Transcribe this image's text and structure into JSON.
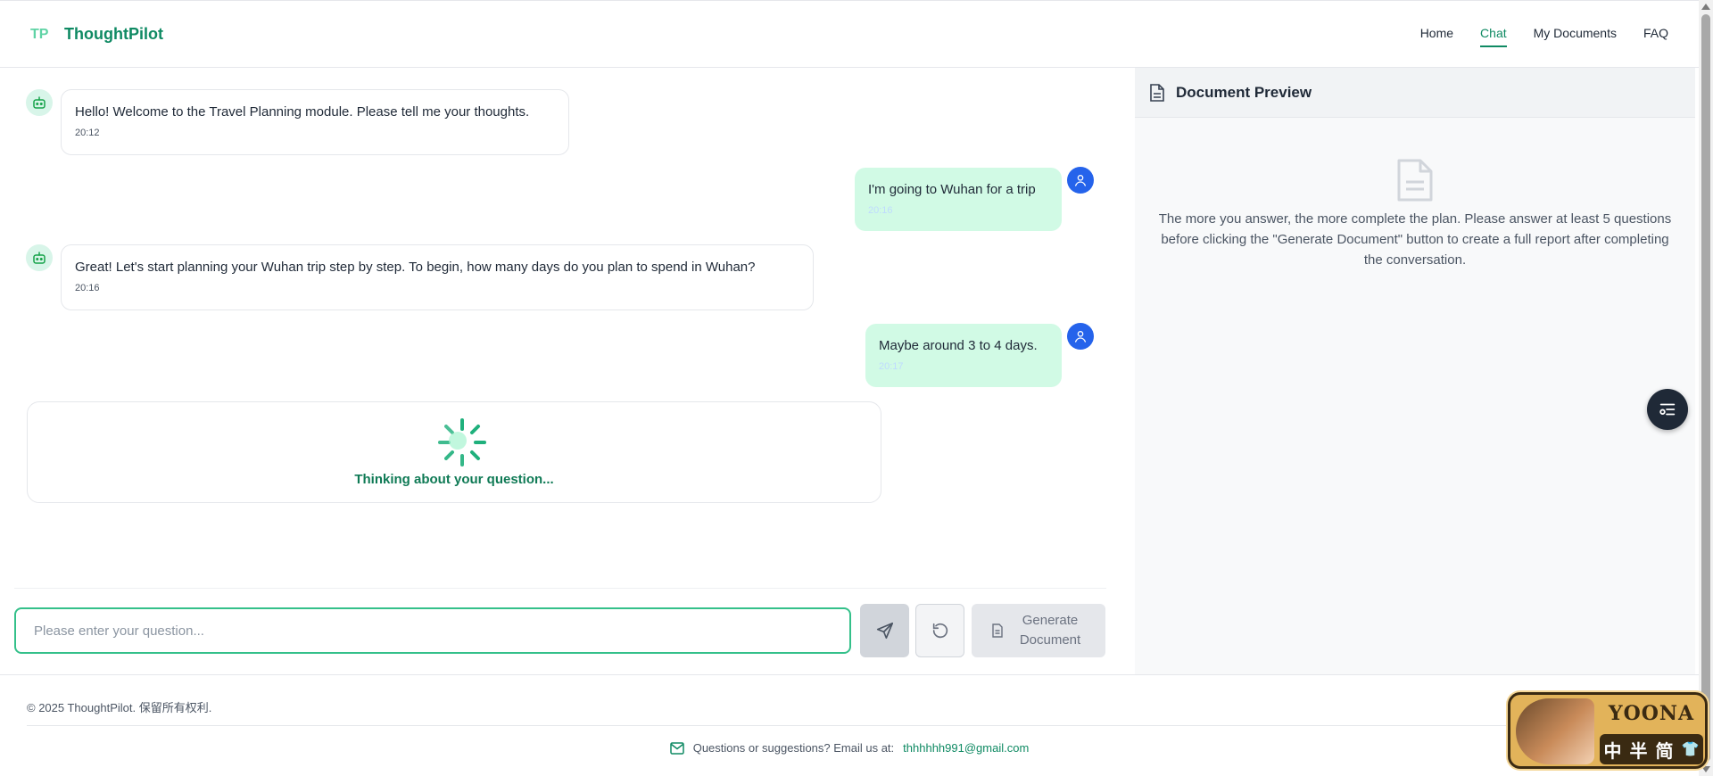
{
  "header": {
    "brand_logo_text": "TP",
    "brand_name": "ThoughtPilot",
    "nav": [
      {
        "label": "Home",
        "active": false
      },
      {
        "label": "Chat",
        "active": true
      },
      {
        "label": "My Documents",
        "active": false
      },
      {
        "label": "FAQ",
        "active": false
      }
    ]
  },
  "messages": [
    {
      "role": "bot",
      "text": "Hello! Welcome to the Travel Planning module. Please tell me your thoughts.",
      "time": "20:12"
    },
    {
      "role": "user",
      "text": "I'm going to Wuhan for a trip",
      "time": "20:16"
    },
    {
      "role": "bot",
      "text": "Great! Let's start planning your Wuhan trip step by step. To begin, how many days do you plan to spend in Wuhan?",
      "time": "20:16"
    },
    {
      "role": "user",
      "text": "Maybe around 3 to 4 days.",
      "time": "20:17"
    }
  ],
  "thinking_text": "Thinking about your question...",
  "composer": {
    "placeholder": "Please enter your question...",
    "generate_label": "Generate Document"
  },
  "preview": {
    "title": "Document Preview",
    "empty_message": "The more you answer, the more complete the plan. Please answer at least 5 questions before clicking the \"Generate Document\" button to create a full report after completing the conversation."
  },
  "footer": {
    "copyright": "© 2025 ThoughtPilot. 保留所有权利.",
    "contact_text": "Questions or suggestions? Email us at:",
    "contact_email": "thhhhhh991@gmail.com"
  },
  "badge": {
    "name": "YOONA",
    "chars": [
      "中",
      "半",
      "简",
      "👕"
    ]
  },
  "colors": {
    "brand": "#0f8a63",
    "user_bubble": "#d1fae5",
    "user_avatar": "#2563eb",
    "bot_avatar_bg": "#d8f5e9",
    "input_border": "#34c08a"
  }
}
